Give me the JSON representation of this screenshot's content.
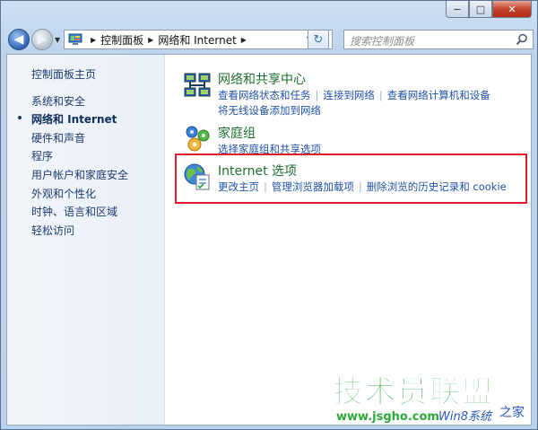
{
  "window": {
    "caption_buttons": {
      "minimize": "−",
      "maximize": "□",
      "close": "✕"
    }
  },
  "navbar": {
    "breadcrumbs": [
      "控制面板",
      "网络和 Internet"
    ],
    "search_placeholder": "搜索控制面板"
  },
  "sidebar": {
    "items": [
      {
        "label": "控制面板主页",
        "active": false
      },
      {
        "label": "系统和安全",
        "active": false
      },
      {
        "label": "网络和 Internet",
        "active": true
      },
      {
        "label": "硬件和声音",
        "active": false
      },
      {
        "label": "程序",
        "active": false
      },
      {
        "label": "用户帐户和家庭安全",
        "active": false
      },
      {
        "label": "外观和个性化",
        "active": false
      },
      {
        "label": "时钟、语言和区域",
        "active": false
      },
      {
        "label": "轻松访问",
        "active": false
      }
    ]
  },
  "categories": [
    {
      "title": "网络和共享中心",
      "icon": "network-sharing-icon",
      "links": [
        "查看网络状态和任务",
        "连接到网络",
        "查看网络计算机和设备"
      ],
      "links2": [
        "将无线设备添加到网络"
      ]
    },
    {
      "title": "家庭组",
      "icon": "homegroup-icon",
      "links": [
        "选择家庭组和共享选项"
      ]
    },
    {
      "title": "Internet 选项",
      "icon": "internet-options-icon",
      "links": [
        "更改主页",
        "管理浏览器加载项",
        "删除浏览的历史记录和 cookie"
      ]
    }
  ],
  "watermark": {
    "main": "技术员联盟",
    "url": "www.jsgho.com",
    "win": "Win8系统",
    "home": "之家"
  },
  "colors": {
    "highlight_border": "#d9202a",
    "category_title": "#1e6e2e",
    "link": "#2051a8",
    "watermark_green": "#2fa93a"
  }
}
